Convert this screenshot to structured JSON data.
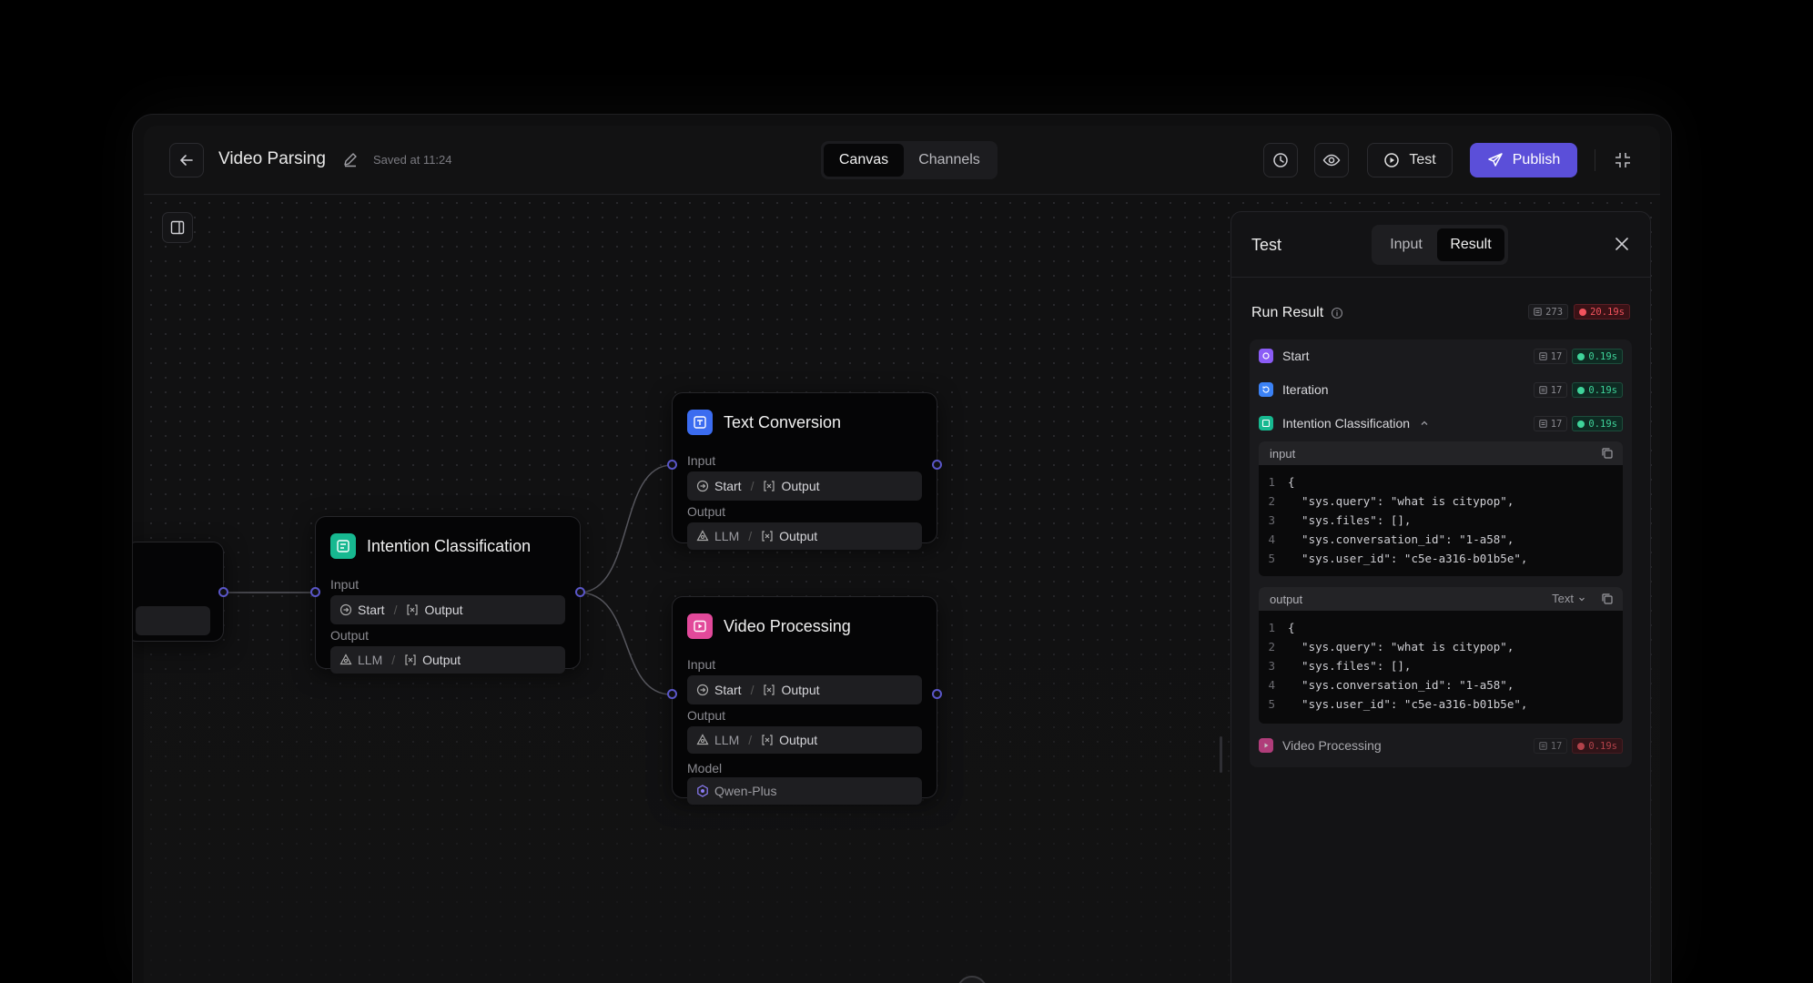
{
  "header": {
    "title": "Video Parsing",
    "saved": "Saved at 11:24",
    "tabs": [
      {
        "label": "Canvas",
        "active": true
      },
      {
        "label": "Channels",
        "active": false
      }
    ],
    "test_label": "Test",
    "publish_label": "Publish",
    "accent": "#5b4fd9"
  },
  "nodes": {
    "intention": {
      "title": "Intention Classification",
      "input_label": "Input",
      "input_src": "Start",
      "input_var": "Output",
      "output_label": "Output",
      "output_src": "LLM",
      "output_var": "Output",
      "color": "#17b890"
    },
    "text_conversion": {
      "title": "Text Conversion",
      "input_label": "Input",
      "input_src": "Start",
      "input_var": "Output",
      "output_label": "Output",
      "output_src": "LLM",
      "output_var": "Output",
      "color": "#3b6cf0"
    },
    "video_processing": {
      "title": "Video Processing",
      "input_label": "Input",
      "input_src": "Start",
      "input_var": "Output",
      "output_label": "Output",
      "output_src": "LLM",
      "output_var": "Output",
      "model_label": "Model",
      "model_value": "Qwen-Plus",
      "color": "#e2499a"
    }
  },
  "test_panel": {
    "title": "Test",
    "tabs": [
      {
        "label": "Input",
        "active": false
      },
      {
        "label": "Result",
        "active": true
      }
    ],
    "run_result_label": "Run Result",
    "total_tokens": "273",
    "total_time": "20.19s",
    "steps": [
      {
        "name": "Start",
        "tokens": "17",
        "time": "0.19s",
        "status": "ok",
        "color": "#8b5cf6"
      },
      {
        "name": "Iteration",
        "tokens": "17",
        "time": "0.19s",
        "status": "ok",
        "color": "#3b82f6"
      },
      {
        "name": "Intention Classification",
        "tokens": "17",
        "time": "0.19s",
        "status": "ok",
        "color": "#17b890"
      },
      {
        "name": "Video Processing",
        "tokens": "17",
        "time": "0.19s",
        "status": "err",
        "color": "#e2499a"
      }
    ],
    "input_block": {
      "label": "input",
      "lines": [
        "{",
        "  \"sys.query\": \"what is citypop\",",
        "  \"sys.files\": [],",
        "  \"sys.conversation_id\": \"1-a58\",",
        "  \"sys.user_id\": \"c5e-a316-b01b5e\","
      ]
    },
    "output_block": {
      "label": "output",
      "format": "Text",
      "lines": [
        "{",
        "  \"sys.query\": \"what is citypop\",",
        "  \"sys.files\": [],",
        "  \"sys.conversation_id\": \"1-a58\",",
        "  \"sys.user_id\": \"c5e-a316-b01b5e\","
      ]
    }
  }
}
